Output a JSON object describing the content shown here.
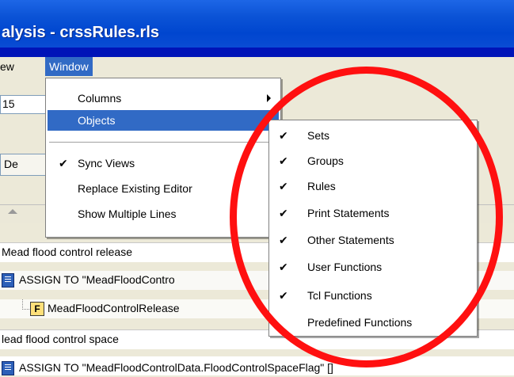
{
  "window": {
    "title": "alysis - crssRules.rls"
  },
  "menubar": {
    "view_label": "ew",
    "window_label": "Window"
  },
  "toolbar": {
    "field_value": "15"
  },
  "tab": {
    "label": "De"
  },
  "window_menu": {
    "items": [
      {
        "label": "Columns"
      },
      {
        "label": "Objects"
      },
      {
        "label": "Sync Views",
        "checked": true
      },
      {
        "label": "Replace Existing Editor"
      },
      {
        "label": "Show Multiple Lines"
      }
    ]
  },
  "objects_menu": {
    "items": [
      {
        "label": "Sets",
        "checked": true
      },
      {
        "label": "Groups",
        "checked": true
      },
      {
        "label": "Rules",
        "checked": true
      },
      {
        "label": "Print Statements",
        "checked": true
      },
      {
        "label": "Other Statements",
        "checked": true
      },
      {
        "label": "User Functions",
        "checked": true
      },
      {
        "label": "Tcl Functions",
        "checked": true
      },
      {
        "label": "Predefined Functions",
        "checked": false
      }
    ]
  },
  "rules": [
    {
      "text": "Mead flood control release"
    },
    {
      "text": "ASSIGN TO \"MeadFloodContro"
    },
    {
      "text": "MeadFloodControlRelease"
    },
    {
      "text": "lead flood control space"
    },
    {
      "text": "ASSIGN TO \"MeadFloodControlData.FloodControlSpaceFlag\" []"
    }
  ],
  "icons": {
    "check": "checkmark-icon",
    "submenu": "submenu-arrow-icon"
  },
  "colors": {
    "highlight": "#316ac5",
    "annotation": "#ff1010",
    "background": "#0014b8"
  }
}
